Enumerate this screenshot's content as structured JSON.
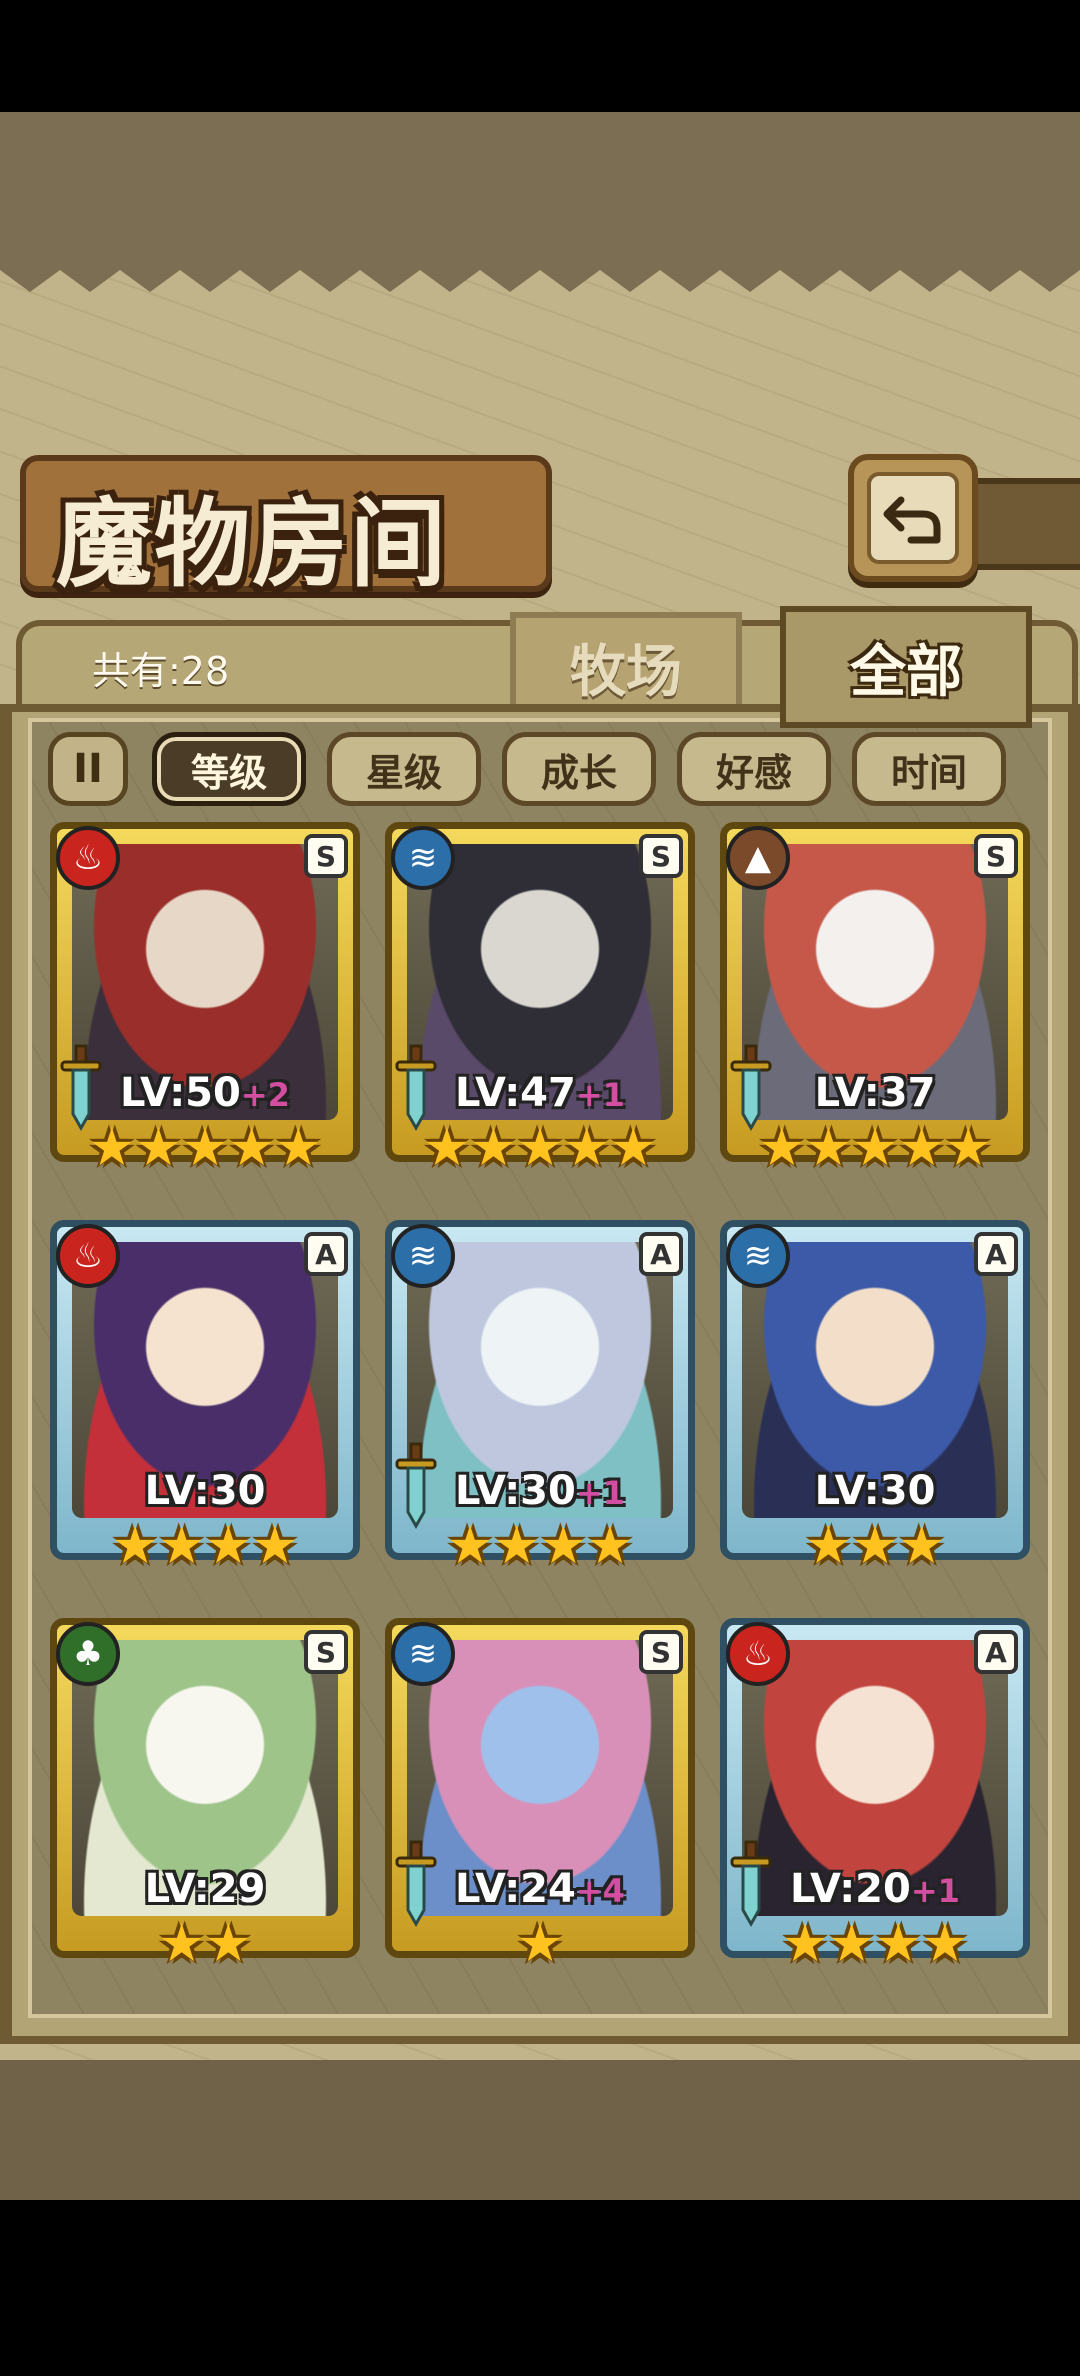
{
  "title": "魔物房间",
  "count_text": "共有:28",
  "tabs": [
    {
      "label": "牧场",
      "selected": false
    },
    {
      "label": "全部",
      "selected": true
    }
  ],
  "sort_options": [
    {
      "label": "等级",
      "selected": true
    },
    {
      "label": "星级",
      "selected": false
    },
    {
      "label": "成长",
      "selected": false
    },
    {
      "label": "好感",
      "selected": false
    },
    {
      "label": "时间",
      "selected": false
    }
  ],
  "sort_toggle_icon": "pause-sort-icon",
  "back_icon": "return-arrow-icon",
  "monsters": [
    {
      "element": "fire",
      "rank": "S",
      "frame": "gold",
      "level": "LV:50",
      "bonus": "+2",
      "stars": 5,
      "weapon": true,
      "palette": [
        "#e7d7c6",
        "#9a2e2a",
        "#3a2f3a"
      ]
    },
    {
      "element": "water",
      "rank": "S",
      "frame": "gold",
      "level": "LV:47",
      "bonus": "+1",
      "stars": 5,
      "weapon": true,
      "palette": [
        "#d9d7d0",
        "#2f2d36",
        "#5a4a6a"
      ]
    },
    {
      "element": "earth",
      "rank": "S",
      "frame": "gold",
      "level": "LV:37",
      "bonus": "",
      "stars": 5,
      "weapon": true,
      "palette": [
        "#f4f0ee",
        "#c6584a",
        "#6b6b7a"
      ]
    },
    {
      "element": "fire",
      "rank": "A",
      "frame": "blue",
      "level": "LV:30",
      "bonus": "",
      "stars": 4,
      "weapon": false,
      "palette": [
        "#f5e2cf",
        "#4a2e6a",
        "#c4303a"
      ]
    },
    {
      "element": "water",
      "rank": "A",
      "frame": "blue",
      "level": "LV:30",
      "bonus": "+1",
      "stars": 4,
      "weapon": true,
      "palette": [
        "#eef3f5",
        "#bfc7df",
        "#7fc0c5"
      ]
    },
    {
      "element": "water",
      "rank": "A",
      "frame": "blue",
      "level": "LV:30",
      "bonus": "",
      "stars": 3,
      "weapon": false,
      "palette": [
        "#f3dfc9",
        "#3c5aa8",
        "#2a2f55"
      ]
    },
    {
      "element": "grass",
      "rank": "S",
      "frame": "gold",
      "level": "LV:29",
      "bonus": "",
      "stars": 2,
      "weapon": false,
      "palette": [
        "#f7f7ef",
        "#9ec48a",
        "#e4e8d0"
      ]
    },
    {
      "element": "water",
      "rank": "S",
      "frame": "gold",
      "level": "LV:24",
      "bonus": "+4",
      "stars": 1,
      "weapon": true,
      "palette": [
        "#9fc0ea",
        "#d990b8",
        "#6d8fc9"
      ]
    },
    {
      "element": "fire",
      "rank": "A",
      "frame": "blue",
      "level": "LV:20",
      "bonus": "+1",
      "stars": 4,
      "weapon": true,
      "palette": [
        "#f6e2d3",
        "#c2443e",
        "#2a2430"
      ]
    }
  ]
}
